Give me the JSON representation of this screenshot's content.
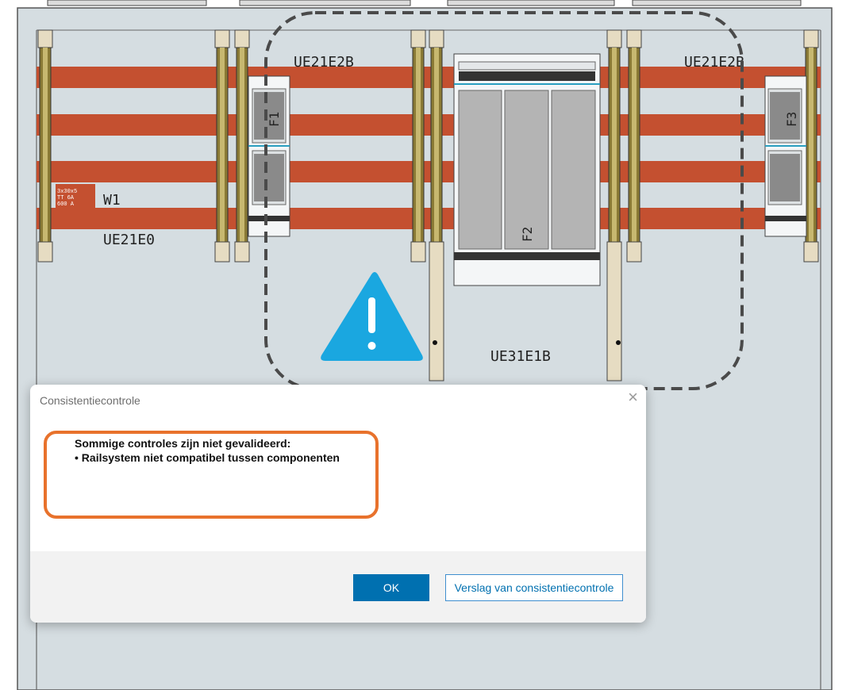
{
  "drawing": {
    "labels": {
      "ue21e2b_left": "UE21E2B",
      "ue21e2b_right": "UE21E2B",
      "w1": "W1",
      "ue21e0": "UE21E0",
      "ue31e1b": "UE31E1B",
      "f1": "F1",
      "f2": "F2",
      "f3": "F3",
      "plate_line1": "3x30x5",
      "plate_line2": "TT 6A",
      "plate_line3": "600 A"
    },
    "colors": {
      "busbar": "#c45030",
      "background": "#d5dde1",
      "warning": "#1aa7e0",
      "highlight": "#e8722c"
    }
  },
  "dialog": {
    "title": "Consistentiecontrole",
    "close_symbol": "×",
    "message_heading": "Sommige controles zijn niet gevalideerd:",
    "message_item": "• Railsystem niet compatibel tussen componenten",
    "ok_label": "OK",
    "report_label": "Verslag van consistentiecontrole"
  }
}
